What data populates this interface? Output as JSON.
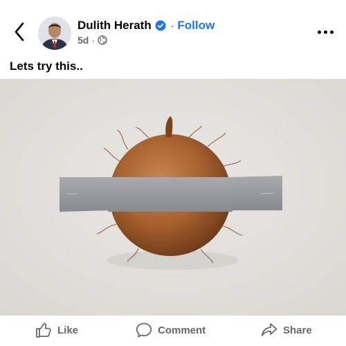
{
  "post": {
    "author": "Dulith Herath",
    "follow_label": "Follow",
    "separator": "·",
    "time_ago": "5d",
    "audience_icon": "globe-icon",
    "caption": "Lets try this.."
  },
  "actions": {
    "like_label": "Like",
    "comment_label": "Comment",
    "share_label": "Share"
  },
  "colors": {
    "accent": "#1877f2",
    "text": "#050505",
    "secondary_text": "#65676b",
    "background": "#ffffff"
  }
}
